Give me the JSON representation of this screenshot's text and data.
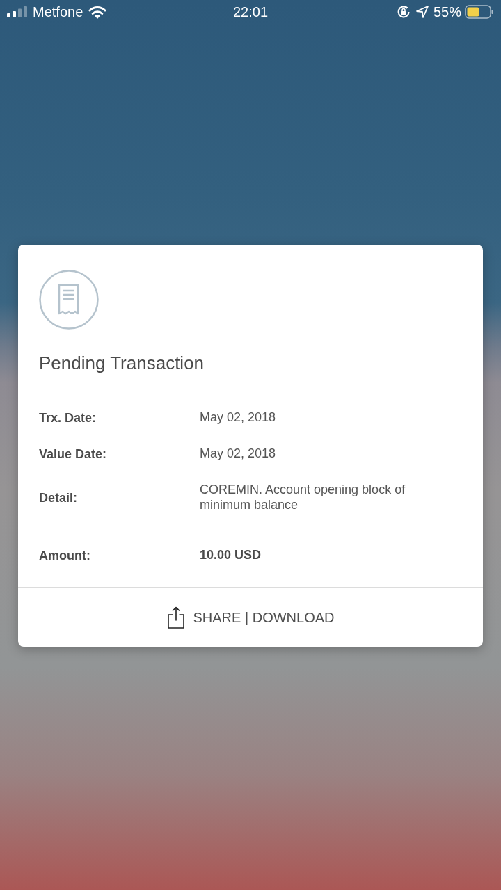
{
  "status_bar": {
    "carrier": "Metfone",
    "time": "22:01",
    "battery": "55%"
  },
  "card": {
    "title": "Pending Transaction",
    "fields": [
      {
        "label": "Trx. Date:",
        "value": "May 02, 2018",
        "emphasis": false
      },
      {
        "label": "Value Date:",
        "value": "May 02, 2018",
        "emphasis": false
      },
      {
        "label": "Detail:",
        "value": "COREMIN. Account opening block of minimum balance",
        "emphasis": false
      },
      {
        "label": "Amount:",
        "value": "10.00 USD",
        "emphasis": true
      }
    ],
    "action": "SHARE | DOWNLOAD"
  }
}
